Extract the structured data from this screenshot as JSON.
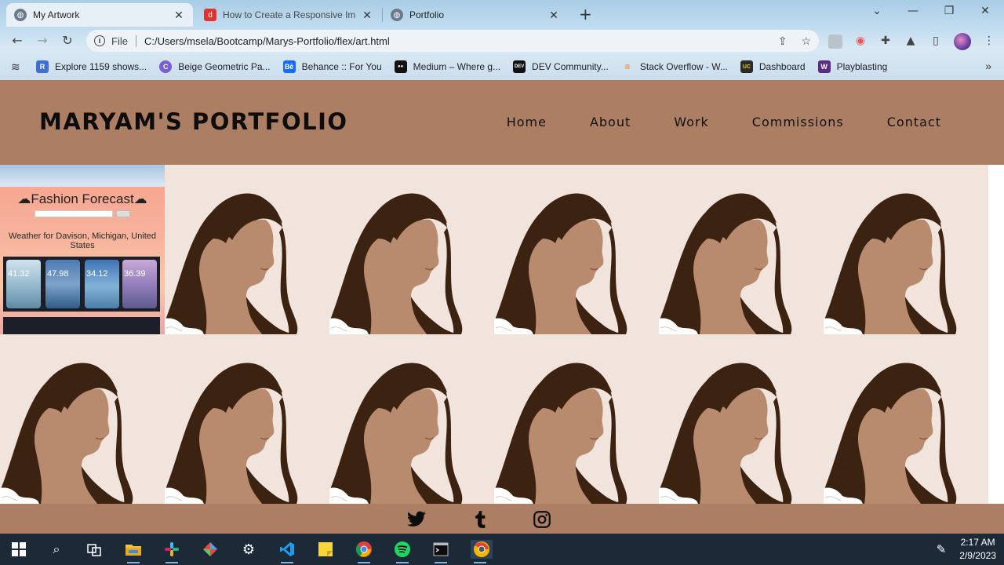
{
  "browser": {
    "tabs": [
      {
        "title": "My Artwork",
        "active": true,
        "favicon": "globe-icon"
      },
      {
        "title": "How to Create a Responsive Image",
        "active": false,
        "favicon": "dev-icon"
      },
      {
        "title": "Portfolio",
        "active": false,
        "favicon": "globe-icon"
      }
    ],
    "omnibox": {
      "scheme": "File",
      "url": "C:/Users/msela/Bootcamp/Marys-Portfolio/flex/art.html"
    },
    "bookmarks": [
      {
        "label": "Explore 1159 shows...",
        "color": "#3d6fd6",
        "glyph": "R"
      },
      {
        "label": "Beige Geometric Pa...",
        "color": "#7a5cd6",
        "glyph": "C"
      },
      {
        "label": "Behance :: For You",
        "color": "#1769ff",
        "glyph": "Bē"
      },
      {
        "label": "Medium – Where g...",
        "color": "#111111",
        "glyph": "●●"
      },
      {
        "label": "DEV Community...",
        "color": "#111111",
        "glyph": "DEV"
      },
      {
        "label": "Stack Overflow - W...",
        "color": "#f48024",
        "glyph": "≡"
      },
      {
        "label": "Dashboard",
        "color": "#2a2a2a",
        "glyph": "UC"
      },
      {
        "label": "Playblasting",
        "color": "#5b2c84",
        "glyph": "W"
      }
    ]
  },
  "site": {
    "brand": "MARYAM'S PORTFOLIO",
    "nav": [
      "Home",
      "About",
      "Work",
      "Commissions",
      "Contact"
    ],
    "featured": {
      "title": "Fashion Forecast",
      "subtitle": "Weather for Davison, Michigan, United States",
      "temps": [
        "41.32",
        "47.98",
        "34.12",
        "36.39"
      ]
    },
    "footer_icons": [
      "twitter-icon",
      "tumblr-icon",
      "instagram-icon"
    ]
  },
  "colors": {
    "header": "#ac7f65",
    "background": "#f1e4dc",
    "hair": "#3c2210",
    "skin": "#b88a6e"
  },
  "taskbar": {
    "time": "2:17 AM",
    "date": "2/9/2023",
    "apps": [
      "windows-start-icon",
      "search-icon",
      "task-view-icon",
      "file-explorer-icon",
      "slack-icon",
      "git-icon",
      "settings-icon",
      "vscode-icon",
      "sticky-notes-icon",
      "chrome-icon",
      "spotify-icon",
      "terminal-icon",
      "chrome-dev-icon"
    ]
  }
}
